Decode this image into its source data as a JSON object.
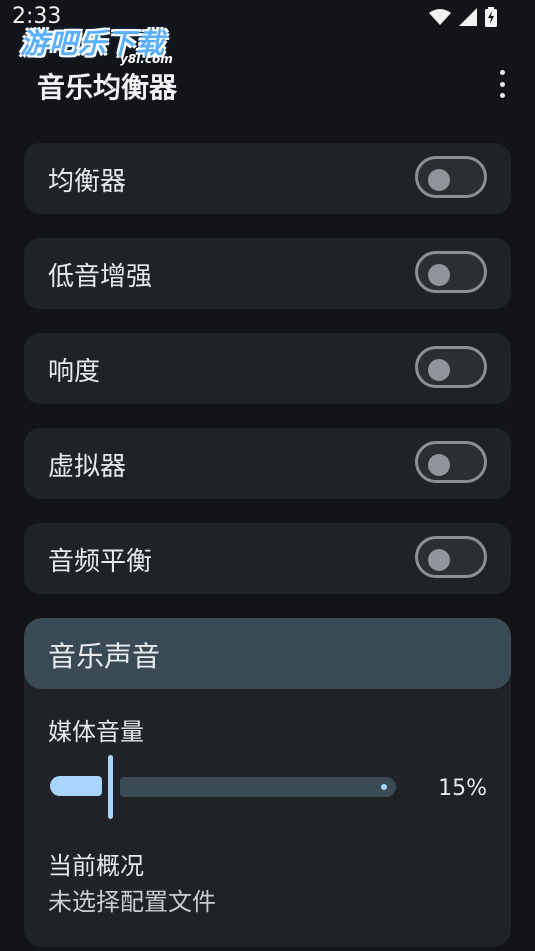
{
  "status": {
    "time": "2:33",
    "wifi_icon": "wifi-icon",
    "signal_icon": "signal-icon",
    "battery_icon": "battery-charging-icon"
  },
  "watermark": {
    "text": "游吧乐下载",
    "sub": "y8l.com"
  },
  "header": {
    "title": "音乐均衡器",
    "more_icon": "more-vert-icon"
  },
  "toggles": [
    {
      "label": "均衡器",
      "on": false
    },
    {
      "label": "低音增强",
      "on": false
    },
    {
      "label": "响度",
      "on": false
    },
    {
      "label": "虚拟器",
      "on": false
    },
    {
      "label": "音频平衡",
      "on": false
    }
  ],
  "sound_panel": {
    "header": "音乐声音",
    "media_volume_label": "媒体音量",
    "volume_percent": 15,
    "volume_text": "15%",
    "current_profile_label": "当前概况",
    "current_profile_value": "未选择配置文件"
  },
  "colors": {
    "background": "#121417",
    "card": "#1f2327",
    "accent": "#a8d4ff",
    "panel_header": "#3a4a55",
    "switch_border": "#8a9096"
  }
}
